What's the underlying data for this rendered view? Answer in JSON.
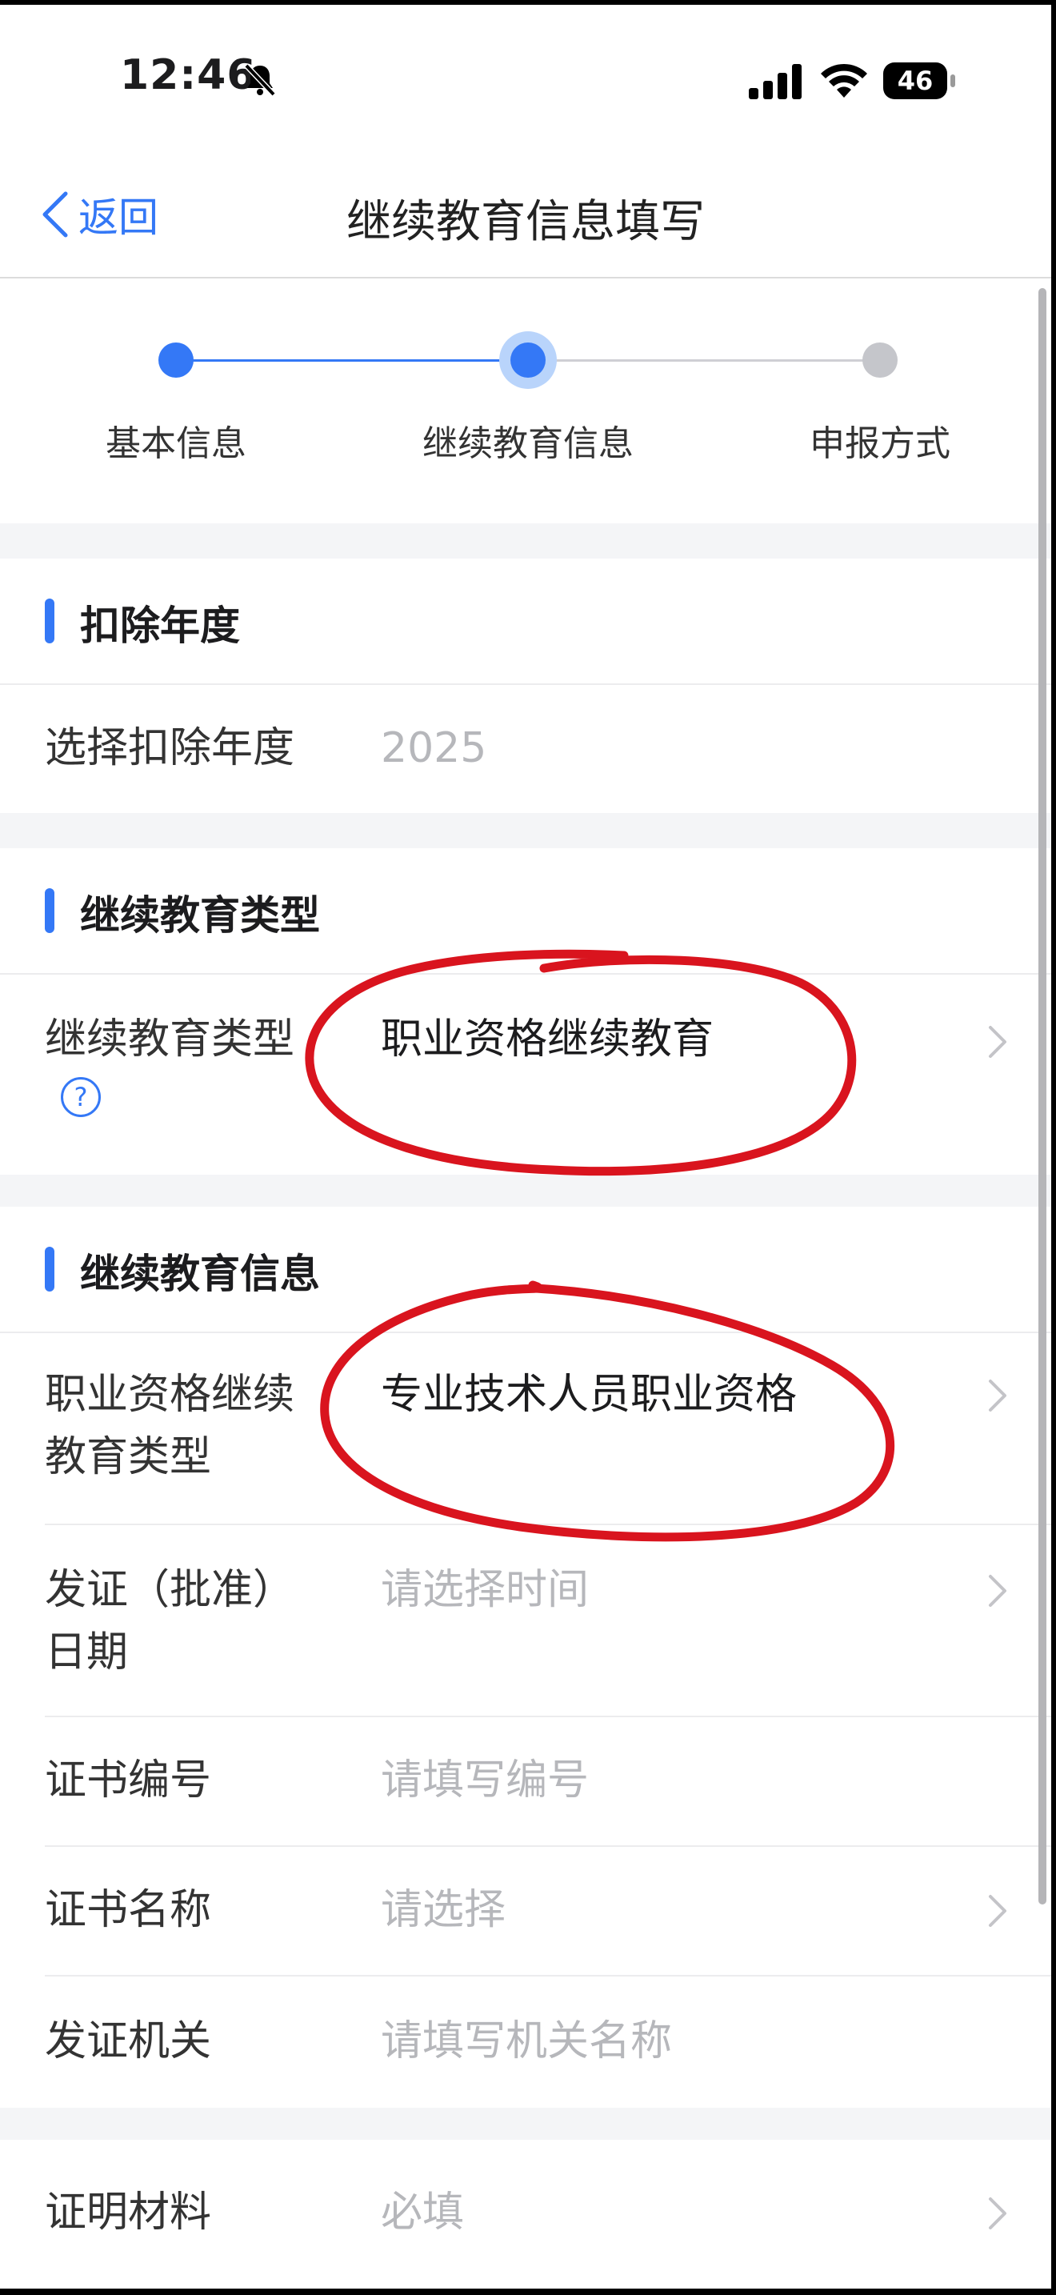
{
  "status_bar": {
    "time": "12:46",
    "battery": "46",
    "icons": [
      "bell-slash-icon",
      "signal-icon",
      "wifi-icon",
      "battery-icon"
    ]
  },
  "nav": {
    "back_label": "返回",
    "title": "继续教育信息填写"
  },
  "stepper": {
    "steps": [
      {
        "label": "基本信息",
        "state": "done"
      },
      {
        "label": "继续教育信息",
        "state": "current"
      },
      {
        "label": "申报方式",
        "state": "pending"
      }
    ]
  },
  "sections": [
    {
      "title": "扣除年度",
      "rows": [
        {
          "label": "选择扣除年度",
          "value": "2025"
        }
      ]
    },
    {
      "title": "继续教育类型",
      "rows": [
        {
          "label": "继续教育类型",
          "value": "职业资格继续教育",
          "help_icon": "help-circle-icon"
        }
      ]
    },
    {
      "title": "继续教育信息",
      "rows": [
        {
          "label": "职业资格继续教育类型",
          "value": "专业技术人员职业资格"
        },
        {
          "label": "发证（批准）日期",
          "placeholder": "请选择时间"
        },
        {
          "label": "证书编号",
          "placeholder": "请填写编号"
        },
        {
          "label": "证书名称",
          "placeholder": "请选择"
        },
        {
          "label": "发证机关",
          "placeholder": "请填写机关名称"
        }
      ]
    },
    {
      "title": "",
      "rows": [
        {
          "label": "证明材料",
          "placeholder": "必填"
        }
      ]
    }
  ],
  "colors": {
    "accent": "#3478f6",
    "annotation": "#d9141e",
    "placeholder": "#b6b7bb"
  }
}
